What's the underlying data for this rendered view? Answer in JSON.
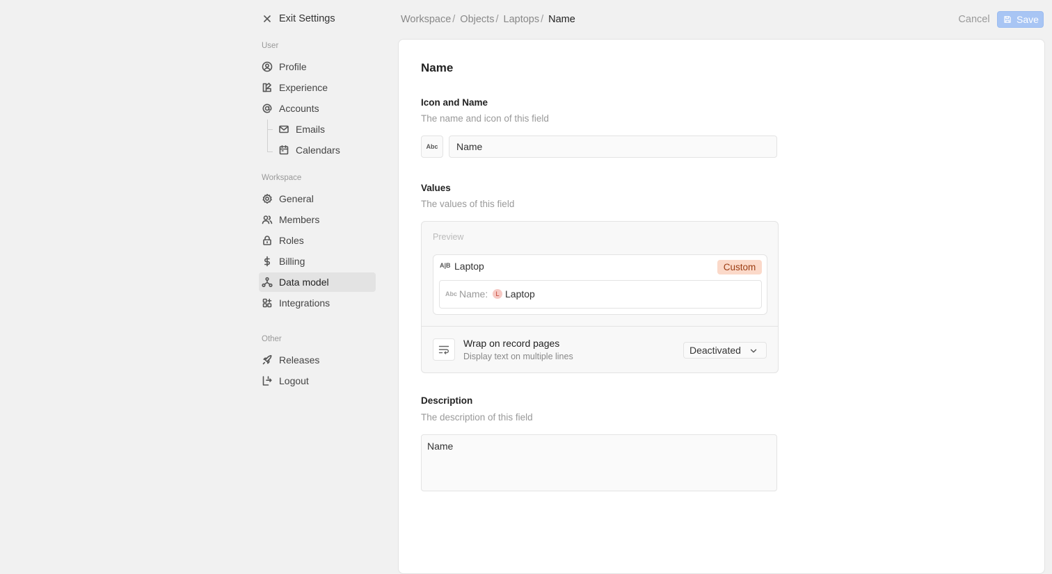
{
  "sidebar": {
    "exit_label": "Exit Settings",
    "sections": {
      "user": "User",
      "workspace": "Workspace",
      "other": "Other"
    },
    "items": {
      "profile": "Profile",
      "experience": "Experience",
      "accounts": "Accounts",
      "emails": "Emails",
      "calendars": "Calendars",
      "general": "General",
      "members": "Members",
      "roles": "Roles",
      "billing": "Billing",
      "data_model": "Data model",
      "integrations": "Integrations",
      "releases": "Releases",
      "logout": "Logout"
    },
    "active_item": "Data model"
  },
  "header": {
    "breadcrumb": [
      "Workspace",
      "Objects",
      "Laptops",
      "Name"
    ],
    "separator": "/",
    "cancel_label": "Cancel",
    "save_label": "Save"
  },
  "main": {
    "title": "Name",
    "icon_name": {
      "heading": "Icon and Name",
      "description": "The name and icon of this field",
      "icon": "Abc",
      "icon_name": "text-type-icon",
      "value": "Name"
    },
    "values": {
      "heading": "Values",
      "description": "The values of this field",
      "preview_label": "Preview",
      "record_icon": "A|B",
      "record_name": "Laptop",
      "badge": "Custom",
      "field_icon": "Abc",
      "field_label": "Name:",
      "chip_avatar": "L",
      "chip_value": "Laptop",
      "wrap_title": "Wrap on record pages",
      "wrap_description": "Display text on multiple lines",
      "wrap_option": "Deactivated"
    },
    "description": {
      "heading": "Description",
      "description": "The description of this field",
      "value": "Name"
    }
  },
  "colors": {
    "accent": "#a8c5f4",
    "badge_bg": "#fbd9c9",
    "badge_text": "#9b3c12",
    "active_nav": "#e3e3e3"
  }
}
